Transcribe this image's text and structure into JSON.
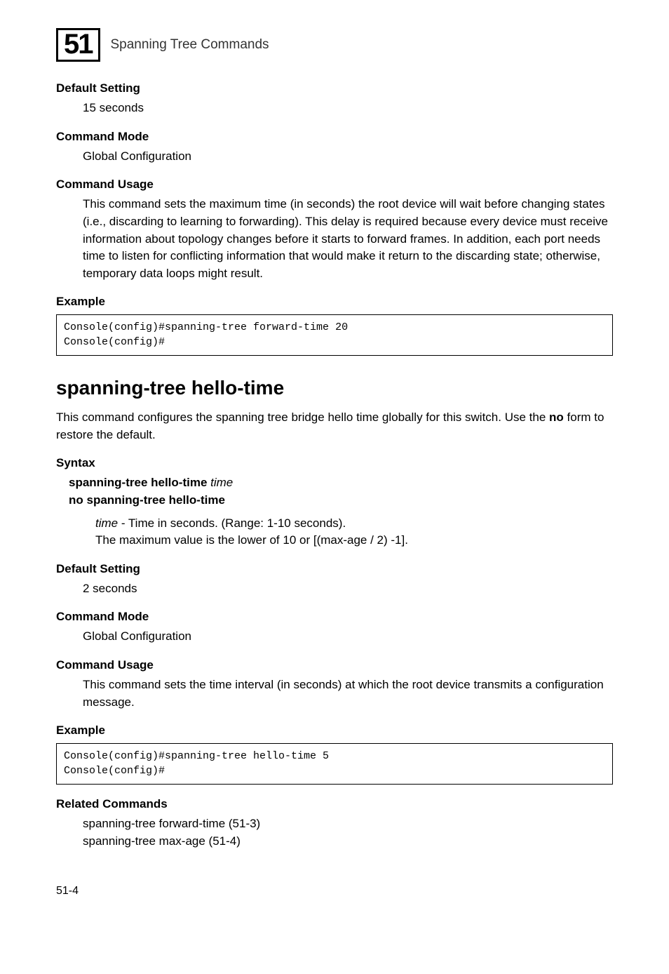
{
  "header": {
    "chapter_number": "51",
    "title": "Spanning Tree Commands"
  },
  "section1": {
    "default_heading": "Default Setting",
    "default_value": "15 seconds",
    "mode_heading": "Command Mode",
    "mode_value": "Global Configuration",
    "usage_heading": "Command Usage",
    "usage_text": "This command sets the maximum time (in seconds) the root device will wait before changing states (i.e., discarding to learning to forwarding). This delay is required because every device must receive information about topology changes before it starts to forward frames. In addition, each port needs time to listen for conflicting information that would make it return to the discarding state; otherwise, temporary data loops might result.",
    "example_heading": "Example",
    "code": "Console(config)#spanning-tree forward-time 20\nConsole(config)#"
  },
  "main_heading": "spanning-tree hello-time",
  "intro_text_part1": "This command configures the spanning tree bridge hello time globally for this switch. Use the ",
  "intro_text_no": "no",
  "intro_text_part2": " form to restore the default.",
  "syntax": {
    "heading": "Syntax",
    "line1_bold": "spanning-tree hello-time ",
    "line1_italic": "time",
    "line2": "no spanning-tree hello-time",
    "param_name": "time",
    "param_desc": " - Time in seconds. (Range: 1-10 seconds).",
    "param_line2": "The maximum value is the lower of 10 or [(max-age / 2) -1]."
  },
  "section2": {
    "default_heading": "Default Setting",
    "default_value": "2 seconds",
    "mode_heading": "Command Mode",
    "mode_value": "Global Configuration",
    "usage_heading": "Command Usage",
    "usage_text": "This command sets the time interval (in seconds) at which the root device transmits a configuration message.",
    "example_heading": "Example",
    "code": "Console(config)#spanning-tree hello-time 5\nConsole(config)#"
  },
  "related": {
    "heading": "Related Commands",
    "line1": "spanning-tree forward-time (51-3)",
    "line2": "spanning-tree max-age (51-4)"
  },
  "page_number": "51-4"
}
